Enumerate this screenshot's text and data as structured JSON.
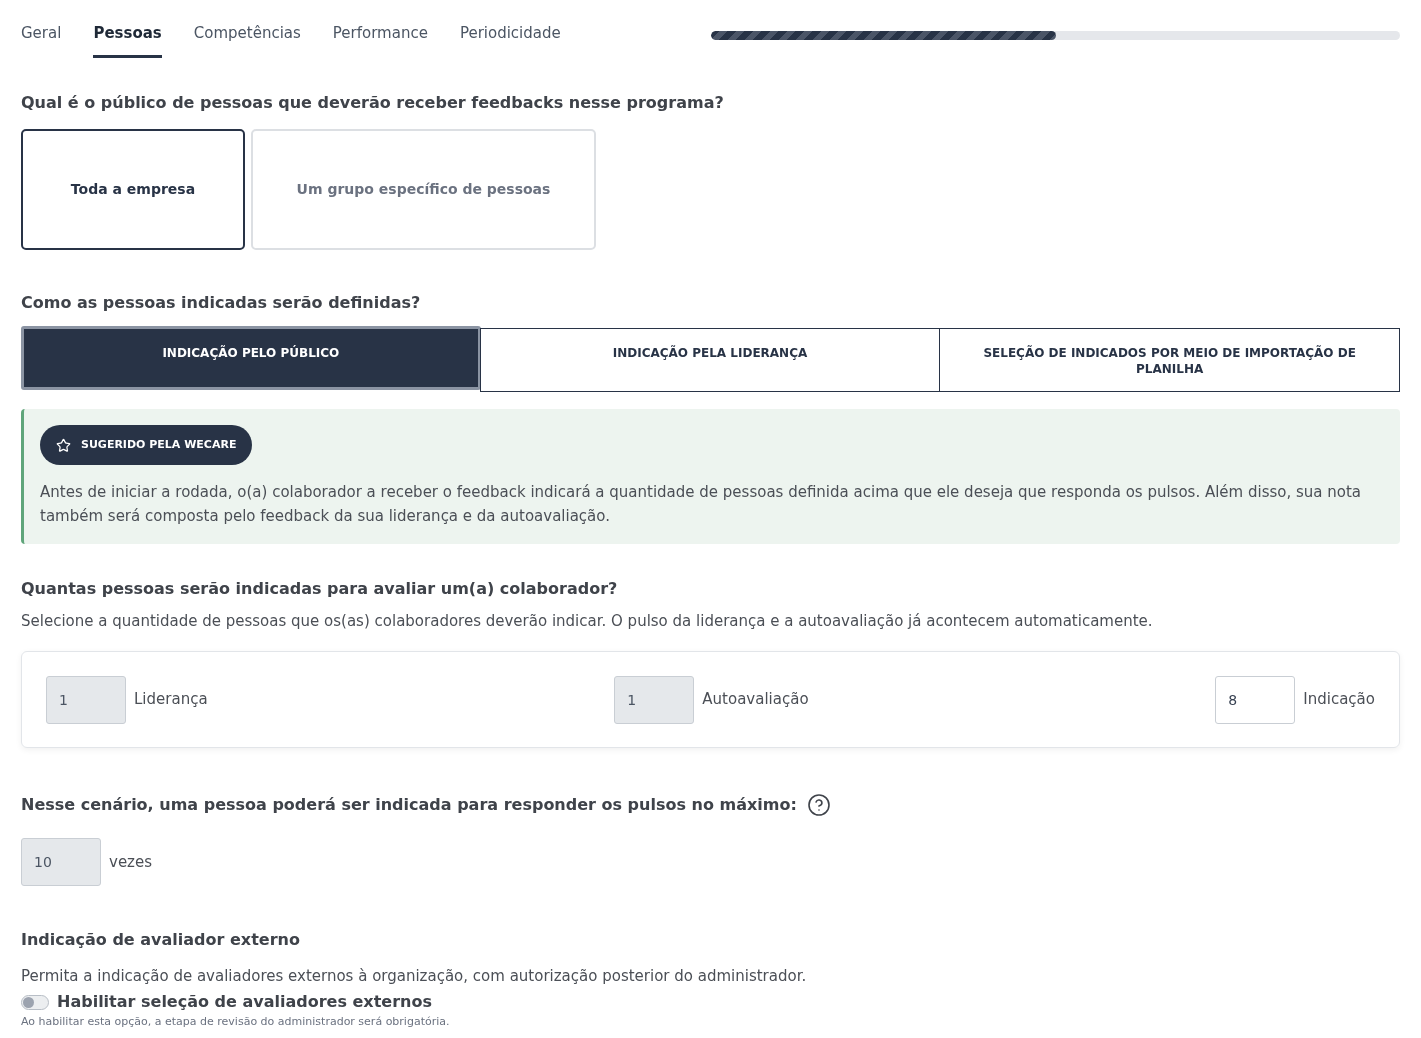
{
  "tabs": [
    {
      "label": "Geral",
      "selected": false
    },
    {
      "label": "Pessoas",
      "selected": true
    },
    {
      "label": "Competências",
      "selected": false
    },
    {
      "label": "Performance",
      "selected": false
    },
    {
      "label": "Periodicidade",
      "selected": false
    }
  ],
  "progress": {
    "level": 0.5
  },
  "audience": {
    "question": "Qual é o público de pessoas que deverão receber feedbacks nesse programa?",
    "options": [
      {
        "label": "Toda a empresa",
        "selected": true
      },
      {
        "label": "Um grupo específico de pessoas",
        "selected": false
      }
    ]
  },
  "definition": {
    "question": "Como as pessoas indicadas serão definidas?",
    "options": [
      {
        "label": "INDICAÇÃO PELO PÚBLICO",
        "selected": true
      },
      {
        "label": "INDICAÇÃO PELA LIDERANÇA",
        "selected": false
      },
      {
        "label": "SELEÇÃO DE INDICADOS POR MEIO DE IMPORTAÇÃO DE PLANILHA",
        "selected": false
      }
    ],
    "suggestion": {
      "badge": "SUGERIDO PELA WECARE",
      "text": "Antes de iniciar a rodada, o(a) colaborador a receber o feedback indicará a quantidade de pessoas definida acima que ele deseja que responda os pulsos. Além disso, sua nota também será composta pelo feedback da sua liderança e da autoavaliação."
    }
  },
  "quantity": {
    "question": "Quantas pessoas serão indicadas para avaliar um(a) colaborador?",
    "description": "Selecione a quantidade de pessoas que os(as) colaboradores deverão indicar. O pulso da liderança e a autoavaliação já acontecem automaticamente.",
    "fields": [
      {
        "value": "1",
        "caption": "Liderança",
        "disabled": true
      },
      {
        "value": "1",
        "caption": "Autoavaliação",
        "disabled": true
      },
      {
        "value": "8",
        "caption": "Indicação",
        "disabled": false
      }
    ]
  },
  "maximum": {
    "question": "Nesse cenário, uma pessoa poderá ser indicada para responder os pulsos no máximo:",
    "field": {
      "value": "10",
      "disabled": true
    },
    "unit": "vezes"
  },
  "external": {
    "title": "Indicação de avaliador externo",
    "description": "Permita a indicação de avaliadores externos à organização, com autorização posterior do administrador.",
    "toggle": {
      "label": "Habilitar seleção de avaliadores externos",
      "on": false
    },
    "note": "Ao habilitar esta opção, a etapa de revisão do administrador será obrigatória."
  }
}
